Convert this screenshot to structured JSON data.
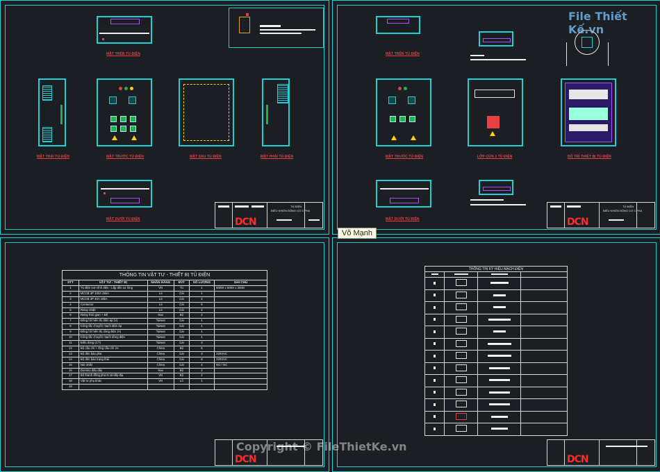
{
  "colors": {
    "line": "#1fd0d6",
    "label": "#e64040",
    "logo": "#ff2a2a",
    "text": "#e6e6e6"
  },
  "sheet1": {
    "labels": {
      "top": "MẶT TRÊN TỦ ĐIỆN",
      "left": "MẶT TRÁI TỦ ĐIỆN",
      "front": "MẶT TRƯỚC TỦ ĐIỆN",
      "back": "MẶT SAU TỦ ĐIỆN",
      "right": "MẶT PHẢI TỦ ĐIỆN",
      "bottom": "MẶT DƯỚI TỦ ĐIỆN"
    },
    "titleblock": {
      "line1": "TỦ ĐIỆN",
      "line2": "ĐIỀU KHIỂN ĐỘNG CƠ 3 PHA",
      "logo": "DCN"
    }
  },
  "sheet2": {
    "labels": {
      "top": "MẶT TRÊN TỦ ĐIỆN",
      "front": "MẶT TRƯỚC TỦ ĐIỆN",
      "door": "LỚP CỬA 2 TỦ ĐIỆN",
      "layout": "BỐ TRÍ THIẾT BỊ TỦ ĐIỆN",
      "bottom": "MẶT DƯỚI TỦ ĐIỆN"
    },
    "titleblock": {
      "line1": "TỦ ĐIỆN",
      "line2": "ĐIỀU KHIỂN ĐỘNG CƠ 3 PHA",
      "logo": "DCN"
    }
  },
  "sheet3": {
    "table_title": "THÔNG TIN VẬT TƯ - THIẾT BỊ TỦ ĐIỆN",
    "headers": [
      "STT",
      "VẬT TƯ - THIẾT BỊ",
      "NHÃN HÀNG",
      "ĐVT",
      "SỐ LƯỢNG",
      "GHI CHÚ"
    ],
    "rows": [
      [
        "1",
        "Tủ điện sơn tĩnh điện - Lắp tiền sơ lòng",
        "VN",
        "Tủ",
        "1",
        "500W x 600H x 250D"
      ],
      [
        "2",
        "MCCB 3P 100A 25kA",
        "LS",
        "Cái",
        "1",
        ""
      ],
      [
        "3",
        "MCCB 3P 40A 18kA",
        "LS",
        "Cái",
        "2",
        ""
      ],
      [
        "4",
        "Contactor",
        "LS",
        "Cái",
        "6",
        ""
      ],
      [
        "5",
        "Relay nhiệt",
        "LS",
        "Cái",
        "2",
        ""
      ],
      [
        "6",
        "Relay thời gian + Đế",
        "Nux",
        "Bộ",
        "2",
        ""
      ],
      [
        "7",
        "Đồng hồ hiển thị điện áp (V)",
        "Taiwan",
        "Cái",
        "1",
        ""
      ],
      [
        "8",
        "Công tắc chuyển mạch điện áp",
        "Taiwan",
        "Cái",
        "1",
        ""
      ],
      [
        "9",
        "Đồng hồ hiển thị dòng điện (A)",
        "Taiwan",
        "Cái",
        "1",
        ""
      ],
      [
        "10",
        "Công tắc chuyển mạch dòng điện",
        "Taiwan",
        "Cái",
        "1",
        ""
      ],
      [
        "11",
        "Biến dòng (CT)",
        "Taiwan",
        "Cái",
        "3",
        ""
      ],
      [
        "12",
        "Bộ cầu chì + Ống cầu chì 2A",
        "China",
        "Bộ",
        "5",
        ""
      ],
      [
        "13",
        "Bộ đèn báo pha",
        "China",
        "Cái",
        "3",
        "220VAC"
      ],
      [
        "14",
        "Bộ đèn báo trạng thái",
        "China",
        "Cái",
        "8",
        "220VAC"
      ],
      [
        "15",
        "Nút nhấn",
        "China",
        "Cái",
        "4",
        "NO / NC"
      ],
      [
        "16",
        "Domino đấu dây",
        "Nux",
        "Bộ",
        "2",
        ""
      ],
      [
        "17",
        "Bộ thanh đồng pha N và tiếp địa",
        "VN",
        "Bộ",
        "2",
        ""
      ],
      [
        "18",
        "Vật tư phụ khác",
        "VN",
        "Lô",
        "1",
        ""
      ],
      [
        "19",
        "",
        "",
        "",
        "",
        ""
      ]
    ],
    "logo": "DCN"
  },
  "sheet4": {
    "table_title": "THÔNG TIN KÝ HIỆU MẠCH ĐIỆN",
    "logo": "DCN"
  },
  "author_badge": "Võ Mạnh",
  "watermark": {
    "top_brand": "File Thiết Kế.vn",
    "bottom": "Copyright © FileThietKe.vn"
  }
}
